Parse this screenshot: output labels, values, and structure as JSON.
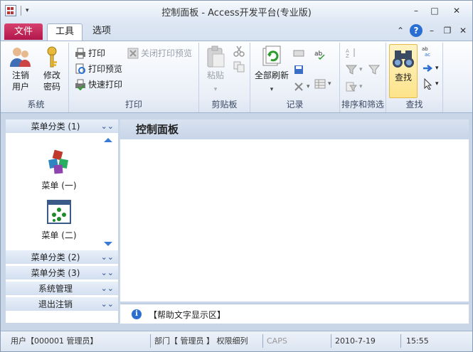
{
  "window": {
    "title": "控制面板 - Access开发平台(专业版)",
    "buttons": {
      "minimize": "–",
      "maximize": "□",
      "close": "✕"
    }
  },
  "tabs": {
    "file": "文件",
    "tools": "工具",
    "options": "选项"
  },
  "ribbon": {
    "system": {
      "label": "系统",
      "logout_user": "注销用户",
      "change_password": "修改密码"
    },
    "print": {
      "label": "打印",
      "print": "打印",
      "print_preview": "打印预览",
      "quick_print": "快速打印",
      "close_preview": "关闭打印预览"
    },
    "clipboard": {
      "label": "剪贴板",
      "paste": "粘贴"
    },
    "records": {
      "label": "记录",
      "refresh_all": "全部刷新"
    },
    "sort_filter": {
      "label": "排序和筛选"
    },
    "find": {
      "label": "查找",
      "find": "查找"
    }
  },
  "nav": {
    "categories": [
      {
        "label": "菜单分类 (1)"
      },
      {
        "label": "菜单分类 (2)"
      },
      {
        "label": "菜单分类 (3)"
      },
      {
        "label": "系统管理"
      },
      {
        "label": "退出注销"
      }
    ],
    "items": [
      {
        "label": "菜单 (一)"
      },
      {
        "label": "菜单 (二)"
      }
    ]
  },
  "content": {
    "title": "控制面板",
    "help_text": "【帮助文字显示区】"
  },
  "statusbar": {
    "user": "用户【000001 管理员】",
    "dept": "部门【 管理员 】 权限细列",
    "caps": "CAPS",
    "date": "2010-7-19",
    "time": "15:55"
  },
  "colors": {
    "file_tab": "#c0245a",
    "accent": "#2a6ed1",
    "find_highlight": "#fde38a"
  }
}
